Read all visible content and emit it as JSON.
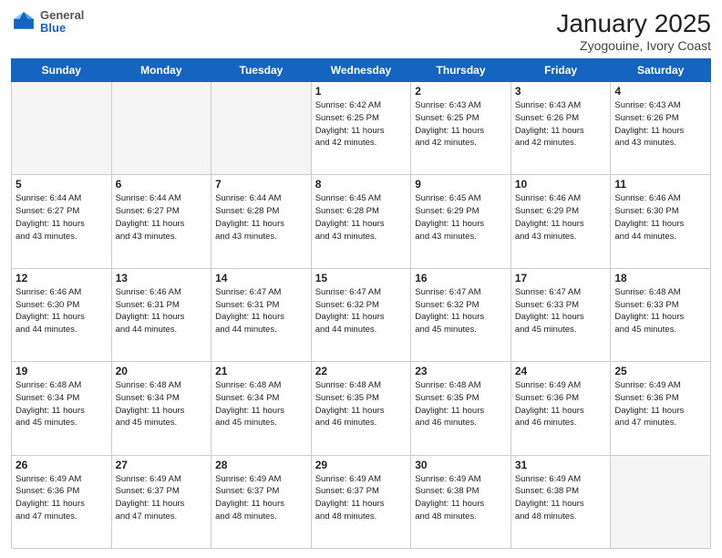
{
  "header": {
    "logo": {
      "general": "General",
      "blue": "Blue"
    },
    "title": "January 2025",
    "subtitle": "Zyogouine, Ivory Coast"
  },
  "weekdays": [
    "Sunday",
    "Monday",
    "Tuesday",
    "Wednesday",
    "Thursday",
    "Friday",
    "Saturday"
  ],
  "weeks": [
    [
      {
        "day": "",
        "info": ""
      },
      {
        "day": "",
        "info": ""
      },
      {
        "day": "",
        "info": ""
      },
      {
        "day": "1",
        "info": "Sunrise: 6:42 AM\nSunset: 6:25 PM\nDaylight: 11 hours\nand 42 minutes."
      },
      {
        "day": "2",
        "info": "Sunrise: 6:43 AM\nSunset: 6:25 PM\nDaylight: 11 hours\nand 42 minutes."
      },
      {
        "day": "3",
        "info": "Sunrise: 6:43 AM\nSunset: 6:26 PM\nDaylight: 11 hours\nand 42 minutes."
      },
      {
        "day": "4",
        "info": "Sunrise: 6:43 AM\nSunset: 6:26 PM\nDaylight: 11 hours\nand 43 minutes."
      }
    ],
    [
      {
        "day": "5",
        "info": "Sunrise: 6:44 AM\nSunset: 6:27 PM\nDaylight: 11 hours\nand 43 minutes."
      },
      {
        "day": "6",
        "info": "Sunrise: 6:44 AM\nSunset: 6:27 PM\nDaylight: 11 hours\nand 43 minutes."
      },
      {
        "day": "7",
        "info": "Sunrise: 6:44 AM\nSunset: 6:28 PM\nDaylight: 11 hours\nand 43 minutes."
      },
      {
        "day": "8",
        "info": "Sunrise: 6:45 AM\nSunset: 6:28 PM\nDaylight: 11 hours\nand 43 minutes."
      },
      {
        "day": "9",
        "info": "Sunrise: 6:45 AM\nSunset: 6:29 PM\nDaylight: 11 hours\nand 43 minutes."
      },
      {
        "day": "10",
        "info": "Sunrise: 6:46 AM\nSunset: 6:29 PM\nDaylight: 11 hours\nand 43 minutes."
      },
      {
        "day": "11",
        "info": "Sunrise: 6:46 AM\nSunset: 6:30 PM\nDaylight: 11 hours\nand 44 minutes."
      }
    ],
    [
      {
        "day": "12",
        "info": "Sunrise: 6:46 AM\nSunset: 6:30 PM\nDaylight: 11 hours\nand 44 minutes."
      },
      {
        "day": "13",
        "info": "Sunrise: 6:46 AM\nSunset: 6:31 PM\nDaylight: 11 hours\nand 44 minutes."
      },
      {
        "day": "14",
        "info": "Sunrise: 6:47 AM\nSunset: 6:31 PM\nDaylight: 11 hours\nand 44 minutes."
      },
      {
        "day": "15",
        "info": "Sunrise: 6:47 AM\nSunset: 6:32 PM\nDaylight: 11 hours\nand 44 minutes."
      },
      {
        "day": "16",
        "info": "Sunrise: 6:47 AM\nSunset: 6:32 PM\nDaylight: 11 hours\nand 45 minutes."
      },
      {
        "day": "17",
        "info": "Sunrise: 6:47 AM\nSunset: 6:33 PM\nDaylight: 11 hours\nand 45 minutes."
      },
      {
        "day": "18",
        "info": "Sunrise: 6:48 AM\nSunset: 6:33 PM\nDaylight: 11 hours\nand 45 minutes."
      }
    ],
    [
      {
        "day": "19",
        "info": "Sunrise: 6:48 AM\nSunset: 6:34 PM\nDaylight: 11 hours\nand 45 minutes."
      },
      {
        "day": "20",
        "info": "Sunrise: 6:48 AM\nSunset: 6:34 PM\nDaylight: 11 hours\nand 45 minutes."
      },
      {
        "day": "21",
        "info": "Sunrise: 6:48 AM\nSunset: 6:34 PM\nDaylight: 11 hours\nand 45 minutes."
      },
      {
        "day": "22",
        "info": "Sunrise: 6:48 AM\nSunset: 6:35 PM\nDaylight: 11 hours\nand 46 minutes."
      },
      {
        "day": "23",
        "info": "Sunrise: 6:48 AM\nSunset: 6:35 PM\nDaylight: 11 hours\nand 46 minutes."
      },
      {
        "day": "24",
        "info": "Sunrise: 6:49 AM\nSunset: 6:36 PM\nDaylight: 11 hours\nand 46 minutes."
      },
      {
        "day": "25",
        "info": "Sunrise: 6:49 AM\nSunset: 6:36 PM\nDaylight: 11 hours\nand 47 minutes."
      }
    ],
    [
      {
        "day": "26",
        "info": "Sunrise: 6:49 AM\nSunset: 6:36 PM\nDaylight: 11 hours\nand 47 minutes."
      },
      {
        "day": "27",
        "info": "Sunrise: 6:49 AM\nSunset: 6:37 PM\nDaylight: 11 hours\nand 47 minutes."
      },
      {
        "day": "28",
        "info": "Sunrise: 6:49 AM\nSunset: 6:37 PM\nDaylight: 11 hours\nand 48 minutes."
      },
      {
        "day": "29",
        "info": "Sunrise: 6:49 AM\nSunset: 6:37 PM\nDaylight: 11 hours\nand 48 minutes."
      },
      {
        "day": "30",
        "info": "Sunrise: 6:49 AM\nSunset: 6:38 PM\nDaylight: 11 hours\nand 48 minutes."
      },
      {
        "day": "31",
        "info": "Sunrise: 6:49 AM\nSunset: 6:38 PM\nDaylight: 11 hours\nand 48 minutes."
      },
      {
        "day": "",
        "info": ""
      }
    ]
  ]
}
